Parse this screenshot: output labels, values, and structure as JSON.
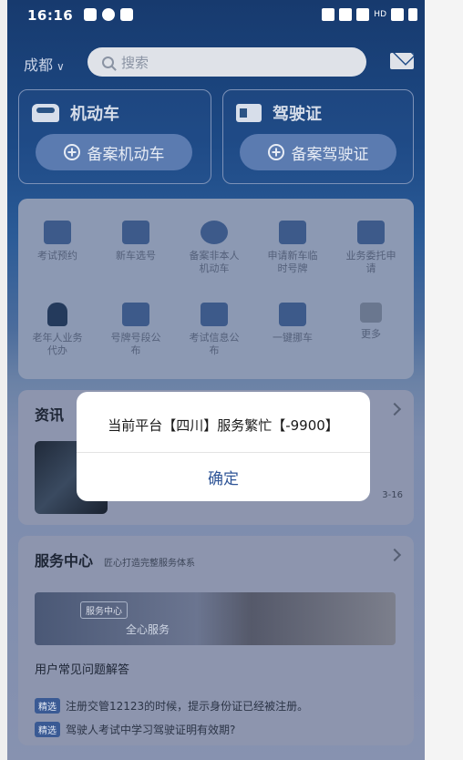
{
  "status": {
    "time": "16:16",
    "network": "HD"
  },
  "topbar": {
    "city": "成都",
    "search_placeholder": "搜索"
  },
  "cards": [
    {
      "title": "机动车",
      "button": "备案机动车"
    },
    {
      "title": "驾驶证",
      "button": "备案驾驶证"
    }
  ],
  "services": [
    {
      "label": "考试预约",
      "icon": "calendar-icon"
    },
    {
      "label": "新车选号",
      "icon": "new-plate-icon"
    },
    {
      "label": "备案非本人机动车",
      "icon": "shield-record-icon"
    },
    {
      "label": "申请新车临时号牌",
      "icon": "temp-plate-icon"
    },
    {
      "label": "业务委托申请",
      "icon": "delegate-icon"
    },
    {
      "label": "老年人业务代办",
      "icon": "elderly-icon"
    },
    {
      "label": "号牌号段公布",
      "icon": "plate-range-icon"
    },
    {
      "label": "考试信息公布",
      "icon": "exam-info-icon"
    },
    {
      "label": "一键挪车",
      "icon": "move-car-icon"
    },
    {
      "label": "更多",
      "icon": "more-icon"
    }
  ],
  "news": {
    "title": "资讯",
    "date_partial": "3-16"
  },
  "service_center": {
    "title": "服务中心",
    "subtitle": "匠心打造完整服务体系",
    "banner_tag": "服务中心",
    "banner_text": "全心服务",
    "faq_title": "用户常见问题解答",
    "faqs": [
      {
        "badge": "精选",
        "text": "注册交管12123的时候，提示身份证已经被注册。"
      },
      {
        "badge": "精选",
        "text": "驾驶人考试中学习驾驶证明有效期?"
      }
    ]
  },
  "dialog": {
    "message": "当前平台【四川】服务繁忙【-9900】",
    "confirm": "确定"
  }
}
